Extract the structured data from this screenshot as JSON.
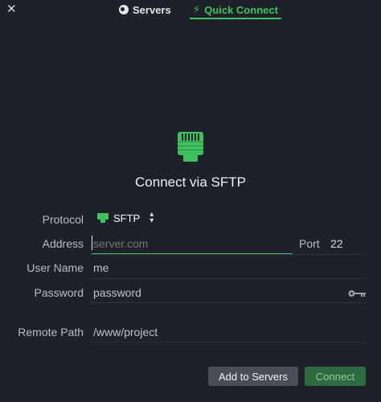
{
  "window": {
    "close_glyph": "✕"
  },
  "tabs": {
    "servers": {
      "label": "Servers",
      "icon": "globe-icon"
    },
    "quick_connect": {
      "label": "Quick Connect",
      "icon": "bolt-icon",
      "active": true
    }
  },
  "hero": {
    "icon": "ethernet-port-icon",
    "title": "Connect via SFTP"
  },
  "form": {
    "protocol": {
      "label": "Protocol",
      "value": "SFTP"
    },
    "address": {
      "label": "Address",
      "placeholder": "server.com",
      "value": ""
    },
    "port": {
      "label": "Port",
      "value": "22"
    },
    "user_name": {
      "label": "User Name",
      "placeholder": "me"
    },
    "password": {
      "label": "Password",
      "placeholder": "password"
    },
    "remote_path": {
      "label": "Remote Path",
      "placeholder": "/www/project"
    }
  },
  "buttons": {
    "add": "Add to Servers",
    "connect": "Connect"
  },
  "colors": {
    "accent": "#3fc15f",
    "background": "#1e2129"
  }
}
